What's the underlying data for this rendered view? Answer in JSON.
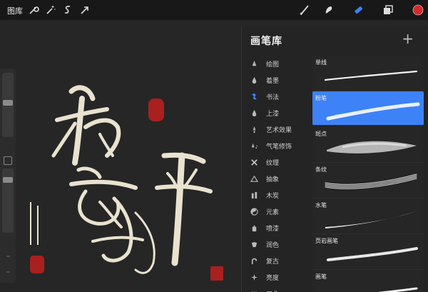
{
  "topbar": {
    "gallery_label": "图库",
    "icons": [
      "wrench-icon",
      "magic-wand-icon",
      "selection-icon",
      "transform-arrow-icon",
      "brush-icon",
      "smudge-icon",
      "eraser-icon",
      "layers-icon",
      "color-icon"
    ],
    "active_color": "#d42a2a",
    "accent": "#3e82f7"
  },
  "panel": {
    "title": "画笔库",
    "add_label": "+",
    "categories": [
      {
        "label": "绘图",
        "icon": "drop-icon"
      },
      {
        "label": "着墨",
        "icon": "ink-drop-icon"
      },
      {
        "label": "书法",
        "icon": "calligraphy-icon",
        "active": true
      },
      {
        "label": "上漆",
        "icon": "paint-drop-icon"
      },
      {
        "label": "艺术效果",
        "icon": "brush-tip-icon"
      },
      {
        "label": "气笔修饰",
        "icon": "airbrush-icon"
      },
      {
        "label": "纹理",
        "icon": "texture-icon"
      },
      {
        "label": "抽象",
        "icon": "triangle-icon"
      },
      {
        "label": "木炭",
        "icon": "charcoal-icon"
      },
      {
        "label": "元素",
        "icon": "yin-yang-icon"
      },
      {
        "label": "喷漆",
        "icon": "spray-can-icon"
      },
      {
        "label": "润色",
        "icon": "retouch-icon"
      },
      {
        "label": "复古",
        "icon": "vintage-icon"
      },
      {
        "label": "亮度",
        "icon": "sparkle-icon"
      },
      {
        "label": "工业",
        "icon": "anvil-icon"
      }
    ],
    "brushes": [
      {
        "label": "单线",
        "selected": false
      },
      {
        "label": "粉笔",
        "selected": true
      },
      {
        "label": "斑点",
        "selected": false
      },
      {
        "label": "条纹",
        "selected": false
      },
      {
        "label": "水笔",
        "selected": false
      },
      {
        "label": "页岩画笔",
        "selected": false
      },
      {
        "label": "画笔",
        "selected": false
      }
    ]
  }
}
